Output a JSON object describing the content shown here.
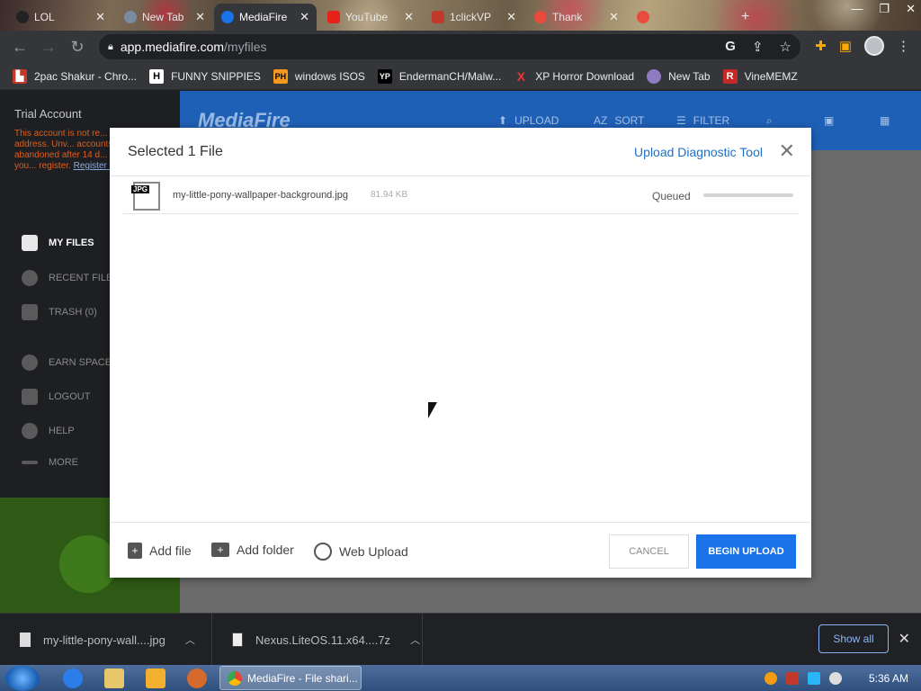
{
  "browser": {
    "tabs": [
      {
        "label": "LOL",
        "active": false
      },
      {
        "label": "New Tab",
        "active": false
      },
      {
        "label": "MediaFire",
        "active": true
      },
      {
        "label": "YouTube",
        "active": false
      },
      {
        "label": "1clickVP",
        "active": false
      },
      {
        "label": "Thank",
        "active": false
      }
    ],
    "url_host": "app.mediafire.com",
    "url_path": "/myfiles",
    "bookmarks": [
      {
        "label": "2pac Shakur - Chro...",
        "icon": "H"
      },
      {
        "label": "FUNNY SNIPPIES",
        "icon": "H"
      },
      {
        "label": "windows ISOS",
        "icon": "PH"
      },
      {
        "label": "EndermanCH/Malw...",
        "icon": "YP"
      },
      {
        "label": "XP Horror Download",
        "icon": "X"
      },
      {
        "label": "New Tab",
        "icon": "globe"
      },
      {
        "label": "VineMEMZ",
        "icon": "R"
      }
    ]
  },
  "sidebar": {
    "account_title": "Trial Account",
    "warning": "This account is not re... an email address. Unv... accounts may be cons... abandoned after 14 d... inactivity, unless you... register.",
    "register_link": "Register no",
    "items": [
      {
        "label": "MY FILES",
        "active": true
      },
      {
        "label": "RECENT FILES",
        "active": false
      },
      {
        "label": "TRASH (0)",
        "active": false
      },
      {
        "label": "EARN SPACE",
        "active": false
      },
      {
        "label": "LOGOUT",
        "active": false
      },
      {
        "label": "HELP",
        "active": false
      },
      {
        "label": "MORE",
        "active": false
      }
    ]
  },
  "topbar": {
    "logo": "MediaFire",
    "upload": "UPLOAD",
    "sort": "SORT",
    "filter": "FILTER"
  },
  "modal": {
    "title": "Selected 1 File",
    "diagnostic_link": "Upload Diagnostic Tool",
    "close": "✕",
    "files": [
      {
        "type_tag": "JPG",
        "name": "my-little-pony-wallpaper-background.jpg",
        "size": "81.94 KB",
        "status": "Queued",
        "progress": 0
      }
    ],
    "footer": {
      "add_file": "Add file",
      "add_folder": "Add folder",
      "web_upload": "Web Upload",
      "cancel": "CANCEL",
      "begin_upload": "BEGIN UPLOAD"
    }
  },
  "downloads": {
    "items": [
      {
        "name": "my-little-pony-wall....jpg"
      },
      {
        "name": "Nexus.LiteOS.11.x64....7z"
      }
    ],
    "show_all": "Show all"
  },
  "taskbar": {
    "active_task": "MediaFire - File shari...",
    "clock": "5:36 AM"
  },
  "colors": {
    "accent_blue": "#1a73e8",
    "mediafire_blue": "#1f60b7",
    "link_blue": "#1f6fc6"
  }
}
